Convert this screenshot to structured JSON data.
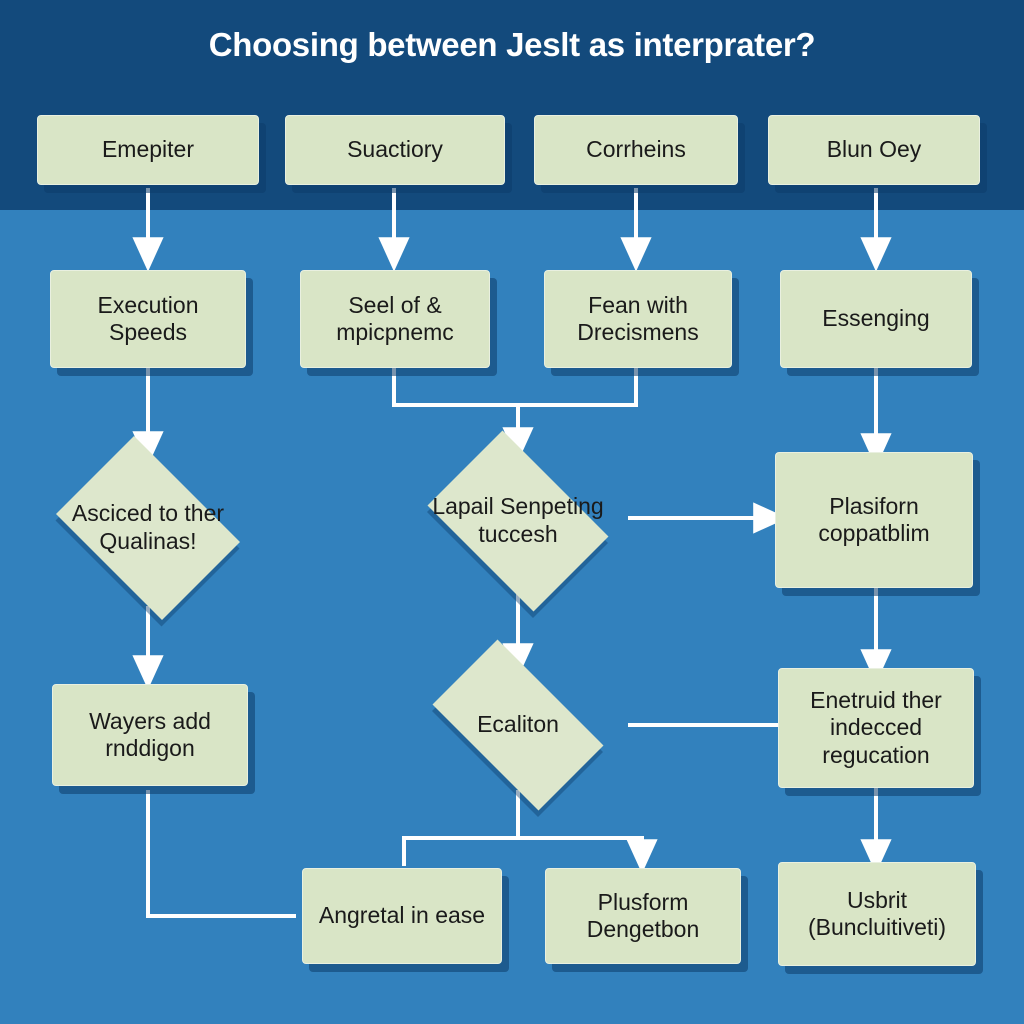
{
  "header": {
    "title": "Choosing between Jeslt as interprater?",
    "band_color": "#134a7c"
  },
  "theme": {
    "background": "#3281bd",
    "node_fill": "#d9e5c6",
    "node_text": "#1a1a1a",
    "connector": "#ffffff",
    "shadow": "#0c3c69"
  },
  "nodes": {
    "row1": [
      {
        "id": "emepiter",
        "label": "Emepiter"
      },
      {
        "id": "suactiory",
        "label": "Suactiory"
      },
      {
        "id": "corrheins",
        "label": "Corrheins"
      },
      {
        "id": "blun-oey",
        "label": "Blun Oey"
      }
    ],
    "row2": [
      {
        "id": "execution-speeds",
        "label": "Execution Speeds"
      },
      {
        "id": "seel-of-mpicpnemc",
        "label": "Seel of & mpicpnemc"
      },
      {
        "id": "fean-with-drecismens",
        "label": "Fean with Drecismens"
      },
      {
        "id": "essenging",
        "label": "Essenging"
      }
    ],
    "row3": [
      {
        "id": "asciced-to-ther-qualinas",
        "label": "Asciced to ther Qualinas!",
        "shape": "diamond"
      },
      {
        "id": "lapail-senpeting-tuccesh",
        "label": "Lapail Senpeting tuccesh",
        "shape": "diamond"
      },
      {
        "id": "plasiforn-coppatblim",
        "label": "Plasiforn coppatblim",
        "shape": "box"
      }
    ],
    "row4": [
      {
        "id": "wayers-add-rnddigon",
        "label": "Wayers add rnddigon",
        "shape": "box"
      },
      {
        "id": "ecaliton",
        "label": "Ecaliton",
        "shape": "diamond"
      },
      {
        "id": "enetruid-ther-indecced-regucation",
        "label": "Enetruid ther indecced regucation",
        "shape": "box"
      }
    ],
    "row5": [
      {
        "id": "angretal-in-ease",
        "label": "Angretal in ease"
      },
      {
        "id": "plusform-dengetbon",
        "label": "Plusform Dengetbon"
      },
      {
        "id": "usbrit-buncluitiveti",
        "label": "Usbrit (Buncluitiveti)"
      }
    ]
  },
  "connections": [
    {
      "from": "emepiter",
      "to": "execution-speeds",
      "type": "vertical-arrow"
    },
    {
      "from": "suactiory",
      "to": "seel-of-mpicpnemc",
      "type": "vertical-arrow"
    },
    {
      "from": "corrheins",
      "to": "fean-with-drecismens",
      "type": "vertical-arrow"
    },
    {
      "from": "blun-oey",
      "to": "essenging",
      "type": "vertical-arrow"
    },
    {
      "from": "execution-speeds",
      "to": "asciced-to-ther-qualinas",
      "type": "vertical-arrow"
    },
    {
      "from": "seel-of-mpicpnemc",
      "to": "lapail-senpeting-tuccesh",
      "type": "merge-arrow"
    },
    {
      "from": "fean-with-drecismens",
      "to": "lapail-senpeting-tuccesh",
      "type": "merge-arrow"
    },
    {
      "from": "essenging",
      "to": "plasiforn-coppatblim",
      "type": "vertical-arrow"
    },
    {
      "from": "asciced-to-ther-qualinas",
      "to": "wayers-add-rnddigon",
      "type": "vertical-arrow"
    },
    {
      "from": "lapail-senpeting-tuccesh",
      "to": "plasiforn-coppatblim",
      "type": "horizontal-arrow"
    },
    {
      "from": "lapail-senpeting-tuccesh",
      "to": "ecaliton",
      "type": "vertical-arrow"
    },
    {
      "from": "plasiforn-coppatblim",
      "to": "enetruid-ther-indecced-regucation",
      "type": "vertical-arrow"
    },
    {
      "from": "ecaliton",
      "to": "enetruid-ther-indecced-regucation",
      "type": "horizontal-line"
    },
    {
      "from": "ecaliton",
      "to": "angretal-in-ease",
      "type": "split-line"
    },
    {
      "from": "ecaliton",
      "to": "plusform-dengetbon",
      "type": "split-arrow"
    },
    {
      "from": "wayers-add-rnddigon",
      "to": "angretal-in-ease",
      "type": "elbow-line"
    },
    {
      "from": "enetruid-ther-indecced-regucation",
      "to": "usbrit-buncluitiveti",
      "type": "vertical-arrow"
    }
  ]
}
